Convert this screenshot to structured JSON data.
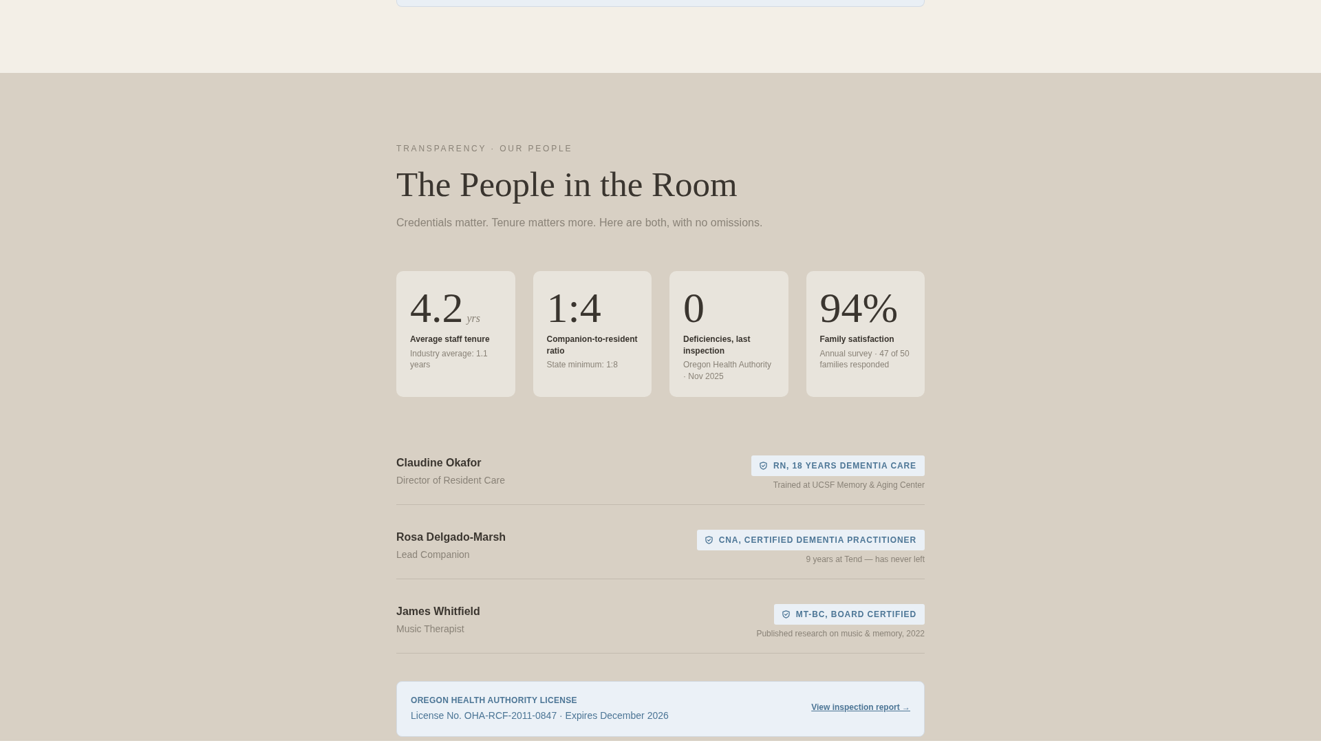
{
  "section": {
    "eyebrow": "TRANSPARENCY · OUR PEOPLE",
    "title": "The People in the Room",
    "subtitle": "Credentials matter. Tenure matters more. Here are both, with no omissions."
  },
  "stats": [
    {
      "value": "4.2",
      "unit": "yrs",
      "label": "Average staff tenure",
      "note": "Industry average: 1.1 years"
    },
    {
      "value": "1:4",
      "label": "Companion-to-resident ratio",
      "note": "State minimum: 1:8"
    },
    {
      "value": "0",
      "label": "Deficiencies, last inspection",
      "note": "Oregon Health Authority · Nov 2025"
    },
    {
      "value": "94%",
      "label": "Family satisfaction",
      "note": "Annual survey · 47 of 50 families responded"
    }
  ],
  "staff": [
    {
      "name": "Claudine Okafor",
      "role": "Director of Resident Care",
      "credential": "RN, 18 YEARS DEMENTIA CARE",
      "credential_note": "Trained at UCSF Memory & Aging Center"
    },
    {
      "name": "Rosa Delgado-Marsh",
      "role": "Lead Companion",
      "credential": "CNA, CERTIFIED DEMENTIA PRACTITIONER",
      "credential_note": "9 years at Tend — has never left"
    },
    {
      "name": "James Whitfield",
      "role": "Music Therapist",
      "credential": "MT-BC, BOARD CERTIFIED",
      "credential_note": "Published research on music & memory, 2022"
    }
  ],
  "license": {
    "heading": "OREGON HEALTH AUTHORITY LICENSE",
    "detail": "License No. OHA-RCF-2011-0847 · Expires December 2026",
    "link": "View inspection report →"
  }
}
